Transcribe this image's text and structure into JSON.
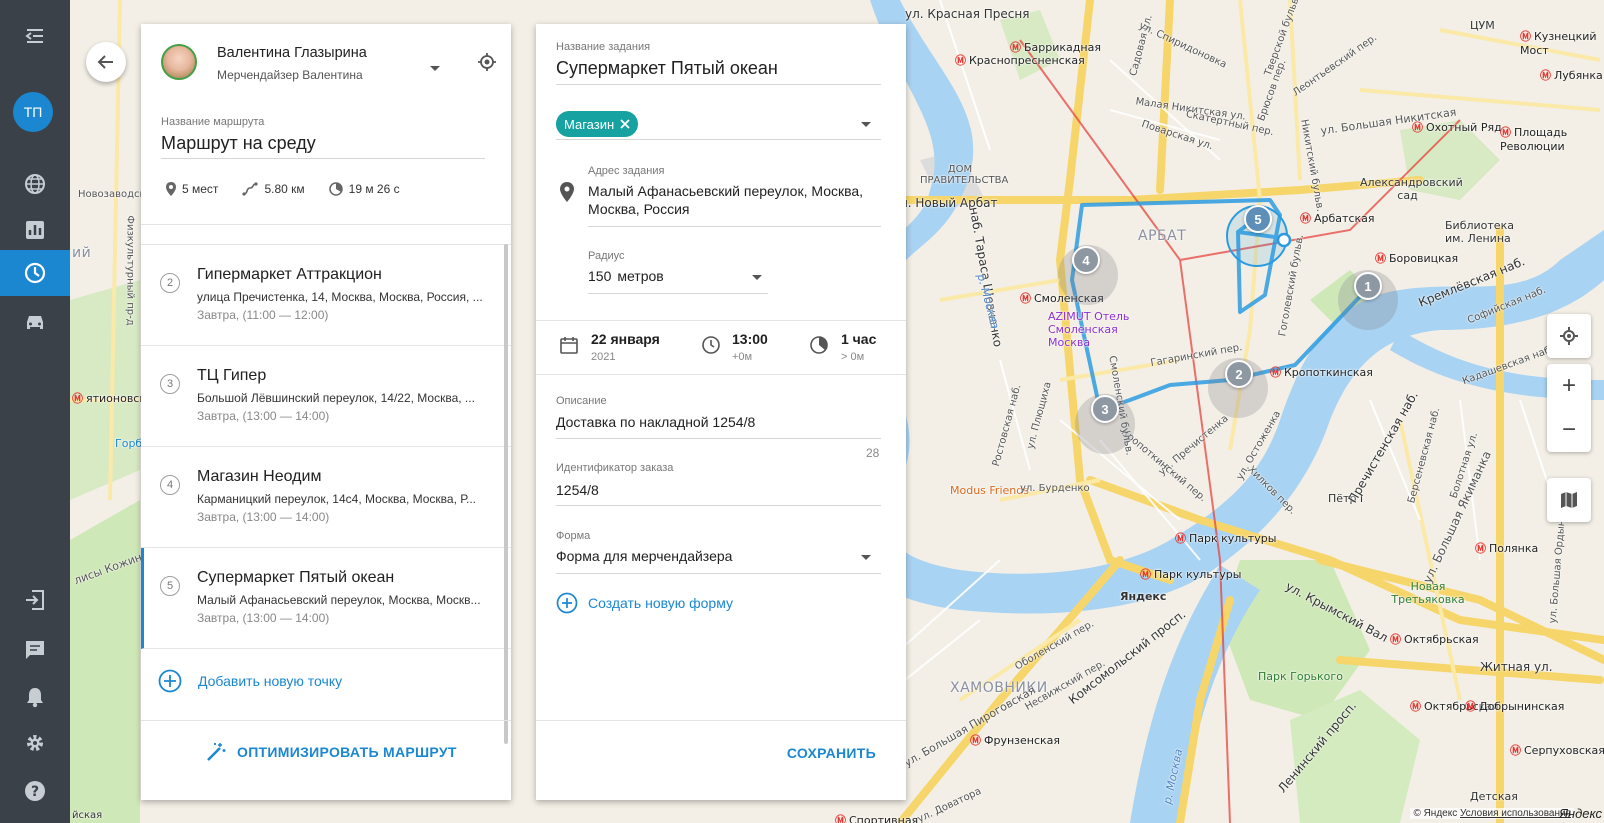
{
  "sidebar": {
    "avatar_initials": "ТП",
    "items": [
      {
        "icon": "menu-collapse-icon"
      },
      {
        "icon": "globe-icon"
      },
      {
        "icon": "analytics-icon"
      },
      {
        "icon": "clock-icon",
        "active": true
      },
      {
        "icon": "car-icon"
      },
      {
        "icon": "logout-icon"
      },
      {
        "icon": "chat-icon"
      },
      {
        "icon": "bell-icon"
      },
      {
        "icon": "gear-icon"
      },
      {
        "icon": "help-icon"
      }
    ]
  },
  "route_panel": {
    "user_name": "Валентина Глазырина",
    "user_role": "Мерчендайзер Валентина",
    "route_name_label": "Название маршрута",
    "route_name": "Маршрут на среду",
    "stats": {
      "places": "5 мест",
      "distance": "5.80 км",
      "duration": "19 м 26 с"
    },
    "points": [
      {
        "num": "2",
        "title": "Гипермаркет Аттракцион",
        "address": "улица Пречистенка, 14, Москва, Москва, Россия, ...",
        "time": "Завтра, (11:00 — 12:00)"
      },
      {
        "num": "3",
        "title": "ТЦ Гипер",
        "address": "Большой Лёвшинский переулок, 14/22, Москва, ...",
        "time": "Завтра, (13:00 — 14:00)"
      },
      {
        "num": "4",
        "title": "Магазин Неодим",
        "address": "Карманицкий переулок, 14с4, Москва, Москва, Р...",
        "time": "Завтра, (13:00 — 14:00)"
      },
      {
        "num": "5",
        "title": "Супермаркет Пятый океан",
        "address": "Малый Афанасьевский переулок, Москва, Москв...",
        "time": "Завтра, (13:00 — 14:00)"
      }
    ],
    "add_point": "Добавить новую точку",
    "optimize": "ОПТИМИЗИРОВАТЬ МАРШРУТ"
  },
  "task_panel": {
    "name_label": "Название задания",
    "name": "Супермаркет Пятый океан",
    "tag": "Магазин",
    "address_label": "Адрес задания",
    "address_line1": "Малый Афанасьевский переулок, Москва,",
    "address_line2": "Москва, Россия",
    "radius_label": "Радиус",
    "radius_value": "150",
    "radius_unit": "метров",
    "date": "22 января",
    "year": "2021",
    "time": "13:00",
    "time_offset": "+0м",
    "duration": "1 час",
    "duration_sub": "> 0м",
    "description_label": "Описание",
    "description": "Доставка по накладной 1254/8",
    "description_count": "28",
    "order_id_label": "Идентификатор заказа",
    "order_id": "1254/8",
    "form_label": "Форма",
    "form": "Форма для мерчендайзера",
    "create_form": "Создать новую форму",
    "save": "СОХРАНИТЬ"
  },
  "map": {
    "markers": [
      "1",
      "2",
      "3",
      "4",
      "5"
    ],
    "labels": {
      "arbat": "АРБАТ",
      "khamovniki": "ХАМОВНИКИ",
      "krasnopresnenskaya": "Краснопресненская",
      "barrikadnaya": "Баррикадная",
      "smolenskaya": "Смоленская",
      "arbatskaya": "Арбатская",
      "borovitskaya": "Боровицкая",
      "kropotkinskaya": "Кропоткинская",
      "park_kultury": "Парк культуры",
      "park_kultury2": "Парк культуры",
      "frunzenskaya": "Фрунзенская",
      "oktyabrskaya": "Октябрьская",
      "oktyabrskaya2": "Октябрьская",
      "okhotny_ryad": "Охотный Ряд",
      "ploshchad_rev": "Площадь Революции",
      "kuznetsky": "Кузнецкий Мост",
      "tsum": "ЦУМ",
      "lubyanka": "Лубянка",
      "polyanka": "Полянка",
      "dobryninskaya": "Добрынинская",
      "serpukhovskaya": "Серпуховская",
      "aleksandrovsky": "Александровский сад",
      "biblioteka": "Библиотека им. Ленина",
      "dom_prav": "ДОМ ПРАВИТЕЛЬСТВА",
      "azimut": "AZIMUT Отель Смоленская Москва",
      "modus": "Modus Friends",
      "yandex": "Яндекс",
      "petr": "Пётр I",
      "tretyakov": "Новая Третьяковка",
      "gorky": "Парк Горького",
      "krymsky": "ул. Крымский Вал",
      "zhitnaya": "Житная ул.",
      "kremlin": "Кремлёвская наб.",
      "sofiyskaya": "Софийская наб.",
      "kadashevskaya": "Кадашевская наб.",
      "prechistenskaya": "Пречистенская наб.",
      "novy_arbat": "ул. Новый Арбат",
      "krasnaya_presnya": "ул. Красная Пресня",
      "komsomolsky": "Комсомольский просп.",
      "leninsky": "Ленинский просп.",
      "shevchenko": "наб. Тараса Шевченко",
      "rostovskaya": "Ростовская наб.",
      "ostozhenka": "ул. Остоженка",
      "prechistenka": "ул. Пречистенка",
      "gagarinsky": "Гагаринский пер.",
      "burdenko": "ул. Бурденко",
      "pliushchikha": "ул. Плющиха",
      "kropotkinsky": "Кропоткинский пер.",
      "novozavodskaya": "Новозаводская",
      "bolshaya_yakimanka": "ул. Большая Якиманка",
      "bolshaya_nikitskaya": "ул. Большая Никитская",
      "malaya_nikitskaya": "Малая Никитская ул.",
      "povarskaya": "Поварская ул.",
      "skatertny": "Скатертный пер.",
      "nikitsky_bulv": "Никитский бульв.",
      "gogolevsky": "Гоголевский бульв.",
      "smolensky_bulv": "Смоленский бульв.",
      "sadovaya": "Садовая ул.",
      "bolshaya_pirogovskaya": "ул. Большая Пироговская",
      "obolensky": "Оболенский пер.",
      "neskuchny": "Несвижский пер.",
      "dovatora": "ул. Доватора",
      "sportivnaya": "Спортивная",
      "detskaya": "Детская",
      "gorbushka": "Горб",
      "ntionovskaya": "ятионовская",
      "kozhinsky": "лисы Кожиной",
      "fizkultur": "Физкультурный пр-д",
      "rosov": "Брюсов пер.",
      "tverskoy": "Тверской бульв.",
      "leontyevsky": "Леонтьевский пер.",
      "spiridonovsky": "ул. Спиридоновка",
      "krasnopresnenskaya2": "Красная Пресня",
      "ii": "ий",
      "yanka": "йская",
      "moscow_river": "р. Москва",
      "moscow_river2": "р. Москва",
      "bolotnaya": "Болотная ул.",
      "bersenevskaya": "Берсеневская наб.",
      "ordynka": "ул. Большая Ордынка",
      "khilkov": "Хилков пер.",
      "conditions": "Условия использования",
      "copyright": "© Яндекс"
    }
  }
}
